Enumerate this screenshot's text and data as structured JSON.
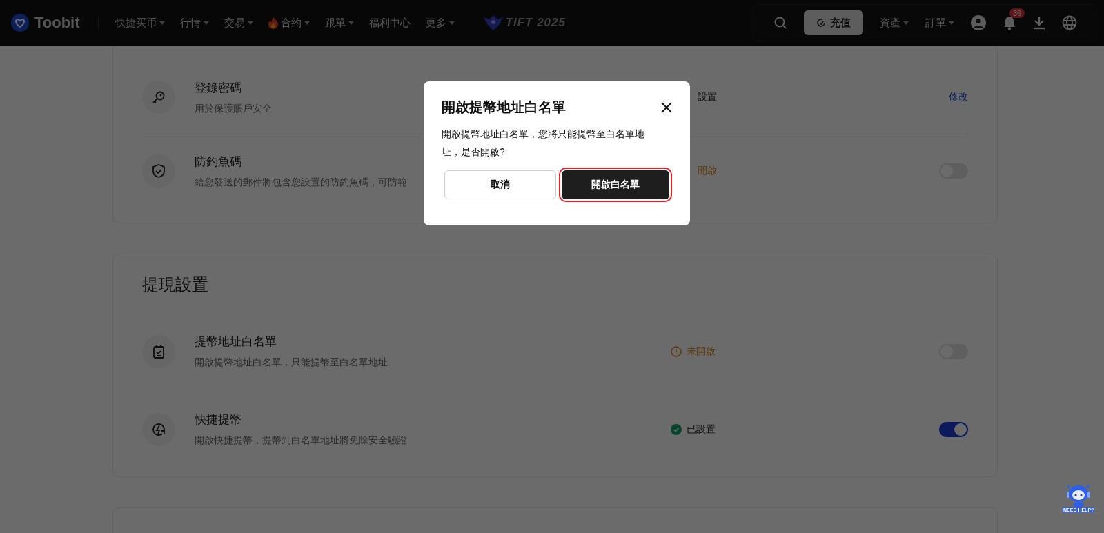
{
  "header": {
    "logo": "Toobit",
    "nav": [
      {
        "label": "快捷买币",
        "caret": true,
        "fire": false
      },
      {
        "label": "行情",
        "caret": true,
        "fire": false
      },
      {
        "label": "交易",
        "caret": true,
        "fire": false
      },
      {
        "label": "合约",
        "caret": true,
        "fire": true
      },
      {
        "label": "跟單",
        "caret": true,
        "fire": false
      },
      {
        "label": "福利中心",
        "caret": false,
        "fire": false
      },
      {
        "label": "更多",
        "caret": true,
        "fire": false
      }
    ],
    "event": "TIFT 2025",
    "deposit": "充值",
    "menus": [
      "資產",
      "訂單"
    ],
    "badge": "36"
  },
  "cards": [
    {
      "rows": [
        {
          "title": "登錄密碼",
          "desc": "用於保護賬戶安全",
          "status": {
            "text": "設置",
            "kind": "set",
            "icon": false
          },
          "kind": "link",
          "link": "修改"
        },
        {
          "title": "防釣魚碼",
          "desc": "給您發送的郵件將包含您設置的防釣魚碼，可防範",
          "status": {
            "text": "開啟",
            "kind": "off",
            "icon": false
          },
          "kind": "toggle",
          "on": false
        }
      ]
    },
    {
      "title": "提現設置",
      "rows": [
        {
          "title": "提幣地址白名單",
          "desc": "開啟提幣地址白名單，只能提幣至白名單地址",
          "status": {
            "text": "未開啟",
            "kind": "off",
            "icon": true
          },
          "kind": "toggle",
          "on": false
        },
        {
          "title": "快捷提幣",
          "desc": "開啟快捷提幣，提幣到白名單地址將免除安全驗證",
          "status": {
            "text": "已設置",
            "kind": "set",
            "icon": true
          },
          "kind": "toggle",
          "on": true
        }
      ]
    }
  ],
  "dialog": {
    "title": "開啟提幣地址白名單",
    "body": "開啟提幣地址白名單，您將只能提幣至白名單地址，是否開啟?",
    "buttons": [
      {
        "label": "取消",
        "kind": "secondary",
        "highlighted": false
      },
      {
        "label": "開啟白名單",
        "kind": "primary",
        "highlighted": true
      }
    ]
  },
  "help": {
    "label": "NEED HELP?"
  }
}
